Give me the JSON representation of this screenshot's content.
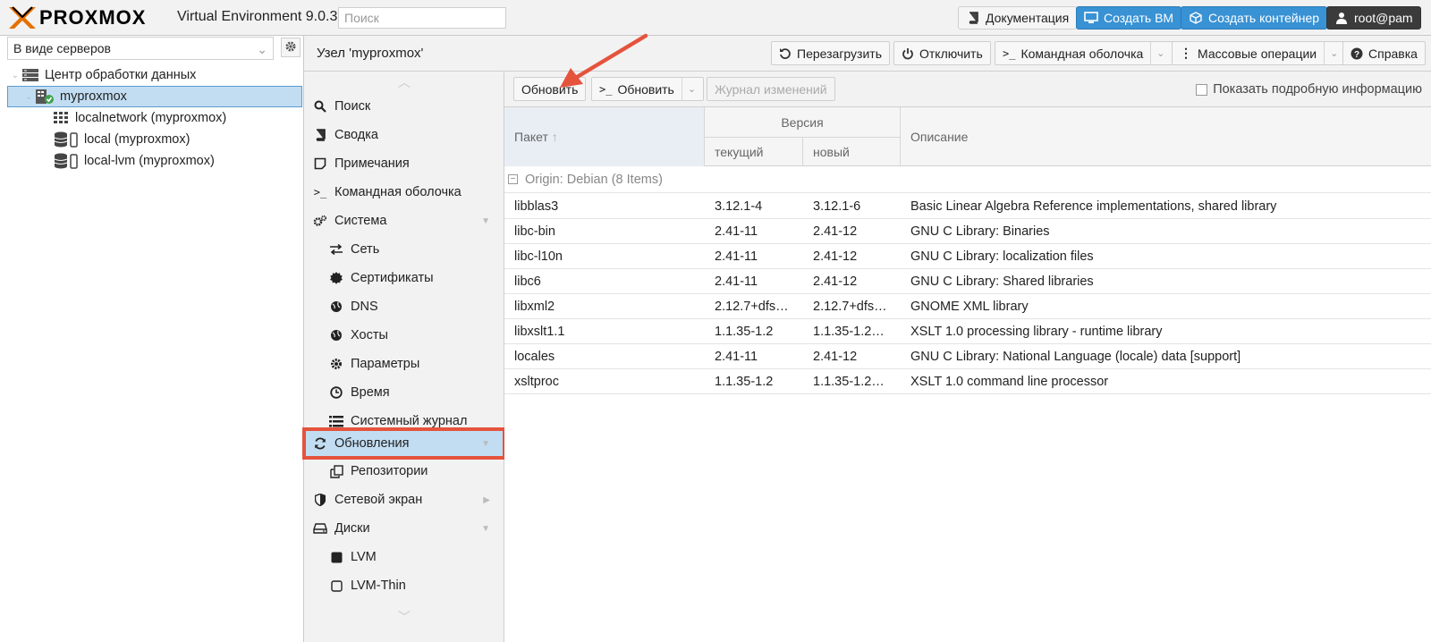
{
  "topbar": {
    "logo_text": "PROXMOX",
    "version": "Virtual Environment 9.0.3",
    "search_placeholder": "Поиск",
    "docs_label": "Документация",
    "create_vm_label": "Создать ВМ",
    "create_ct_label": "Создать контейнер",
    "user_label": "root@pam"
  },
  "left": {
    "view_select": "В виде серверов",
    "tree": [
      {
        "label": "Центр обработки данных",
        "icon": "datacenter-icon"
      },
      {
        "label": "myproxmox",
        "icon": "node-icon"
      },
      {
        "label": "localnetwork (myproxmox)",
        "icon": "network-icon"
      },
      {
        "label": "local (myproxmox)",
        "icon": "storage-icon"
      },
      {
        "label": "local-lvm (myproxmox)",
        "icon": "storage-icon"
      }
    ]
  },
  "header": {
    "node_title": "Узел 'myproxmox'",
    "reboot": "Перезагрузить",
    "shutdown": "Отключить",
    "shell": "Командная оболочка",
    "bulk": "Массовые операции",
    "help": "Справка"
  },
  "nav": {
    "items": [
      {
        "label": "Поиск",
        "icon": "search-icon"
      },
      {
        "label": "Сводка",
        "icon": "book-icon"
      },
      {
        "label": "Примечания",
        "icon": "notes-icon"
      },
      {
        "label": "Командная оболочка",
        "icon": "terminal-icon"
      },
      {
        "label": "Система",
        "icon": "cogs-icon"
      },
      {
        "label": "Сеть",
        "icon": "exchange-icon"
      },
      {
        "label": "Сертификаты",
        "icon": "certificate-icon"
      },
      {
        "label": "DNS",
        "icon": "globe-icon"
      },
      {
        "label": "Хосты",
        "icon": "globe-icon"
      },
      {
        "label": "Параметры",
        "icon": "gear-icon"
      },
      {
        "label": "Время",
        "icon": "clock-icon"
      },
      {
        "label": "Системный журнал",
        "icon": "list-icon"
      },
      {
        "label": "Обновления",
        "icon": "refresh-icon"
      },
      {
        "label": "Репозитории",
        "icon": "files-icon"
      },
      {
        "label": "Сетевой экран",
        "icon": "shield-icon"
      },
      {
        "label": "Диски",
        "icon": "hdd-icon"
      },
      {
        "label": "LVM",
        "icon": "square-icon"
      },
      {
        "label": "LVM-Thin",
        "icon": "square-outline-icon"
      }
    ]
  },
  "toolbar": {
    "refresh": "Обновить",
    "upgrade": "Обновить",
    "changelog": "Журнал изменений",
    "show_details": "Показать подробную информацию"
  },
  "table": {
    "col_package": "Пакет",
    "col_version": "Версия",
    "col_current": "текущий",
    "col_new": "новый",
    "col_desc": "Описание",
    "group_label": "Origin: Debian (8 Items)",
    "rows": [
      {
        "pkg": "libblas3",
        "cur": "3.12.1-4",
        "new": "3.12.1-6",
        "desc": "Basic Linear Algebra Reference implementations, shared library"
      },
      {
        "pkg": "libc-bin",
        "cur": "2.41-11",
        "new": "2.41-12",
        "desc": "GNU C Library: Binaries"
      },
      {
        "pkg": "libc-l10n",
        "cur": "2.41-11",
        "new": "2.41-12",
        "desc": "GNU C Library: localization files"
      },
      {
        "pkg": "libc6",
        "cur": "2.41-11",
        "new": "2.41-12",
        "desc": "GNU C Library: Shared libraries"
      },
      {
        "pkg": "libxml2",
        "cur": "2.12.7+dfs…",
        "new": "2.12.7+dfs…",
        "desc": "GNOME XML library"
      },
      {
        "pkg": "libxslt1.1",
        "cur": "1.1.35-1.2",
        "new": "1.1.35-1.2…",
        "desc": "XSLT 1.0 processing library - runtime library"
      },
      {
        "pkg": "locales",
        "cur": "2.41-11",
        "new": "2.41-12",
        "desc": "GNU C Library: National Language (locale) data [support]"
      },
      {
        "pkg": "xsltproc",
        "cur": "1.1.35-1.2",
        "new": "1.1.35-1.2…",
        "desc": "XSLT 1.0 command line processor"
      }
    ]
  },
  "colors": {
    "accent_blue": "#3892d4",
    "selection": "#c2ddf2",
    "highlight_red": "#e5533d"
  }
}
